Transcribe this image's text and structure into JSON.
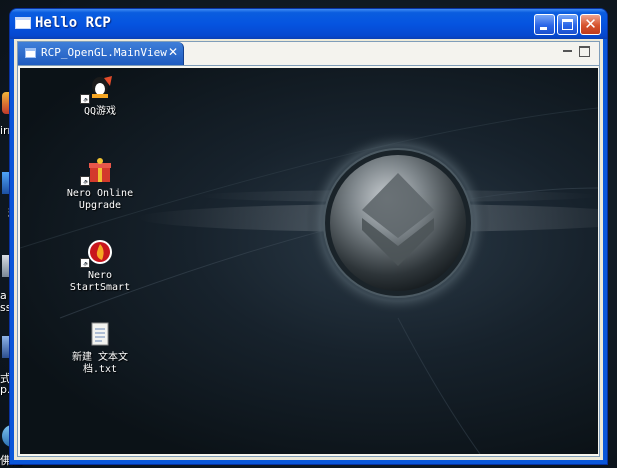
{
  "window": {
    "title": "Hello RCP"
  },
  "view": {
    "tab_label": "RCP_OpenGL.MainView",
    "tab_close": "✕"
  },
  "desktop_left": [
    {
      "label": "irmp"
    },
    {
      "label": "精灵"
    },
    {
      "label": "a Layer"
    },
    {
      "label": "ssic"
    },
    {
      "label": "式 到"
    },
    {
      "label": "p.exe"
    },
    {
      "label": "佛龙"
    }
  ],
  "icons": [
    {
      "line1": "QQ游戏",
      "line2": ""
    },
    {
      "line1": "Nero Online",
      "line2": "Upgrade"
    },
    {
      "line1": "Nero",
      "line2": "StartSmart"
    },
    {
      "line1": "新建 文本文",
      "line2": "档.txt"
    }
  ],
  "colors": {
    "titlebar": "#0554e0",
    "close": "#d6532d",
    "canvas": "#17222c"
  }
}
